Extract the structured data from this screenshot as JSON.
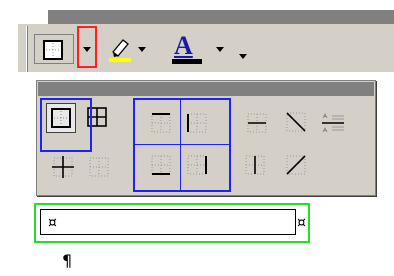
{
  "toolbar": {
    "buttons": [
      {
        "name": "outside-border-button",
        "icon": "outside-border-icon"
      },
      {
        "name": "border-dropdown-arrow",
        "icon": "chevron-down-icon"
      },
      {
        "name": "highlight-button",
        "icon": "highlighter-icon",
        "color": "#ffff00"
      },
      {
        "name": "highlight-dropdown-arrow",
        "icon": "chevron-down-icon"
      },
      {
        "name": "font-color-button",
        "label": "A",
        "icon": "font-color-icon",
        "color": "#000000"
      },
      {
        "name": "font-color-dropdown-arrow",
        "icon": "chevron-down-icon"
      },
      {
        "name": "toolbar-options-arrow",
        "icon": "chevron-down-icon"
      }
    ]
  },
  "border_palette": {
    "rows": [
      [
        "outside-borders",
        "all-borders",
        "top-border",
        "left-border",
        "inside-horizontal-border",
        "diagonal-down-border",
        "horizontal-line"
      ],
      [
        "inside-borders",
        "no-border",
        "bottom-border",
        "right-border",
        "inside-vertical-border",
        "diagonal-up-border"
      ]
    ],
    "selected": "outside-borders"
  },
  "document": {
    "cell_end_marker": "¤",
    "paragraph_mark": "¶"
  },
  "colors": {
    "annotation_red": "#ff2020",
    "annotation_blue": "#2020ff",
    "annotation_green": "#20e020",
    "toolbar_face": "#d4d0c8"
  }
}
